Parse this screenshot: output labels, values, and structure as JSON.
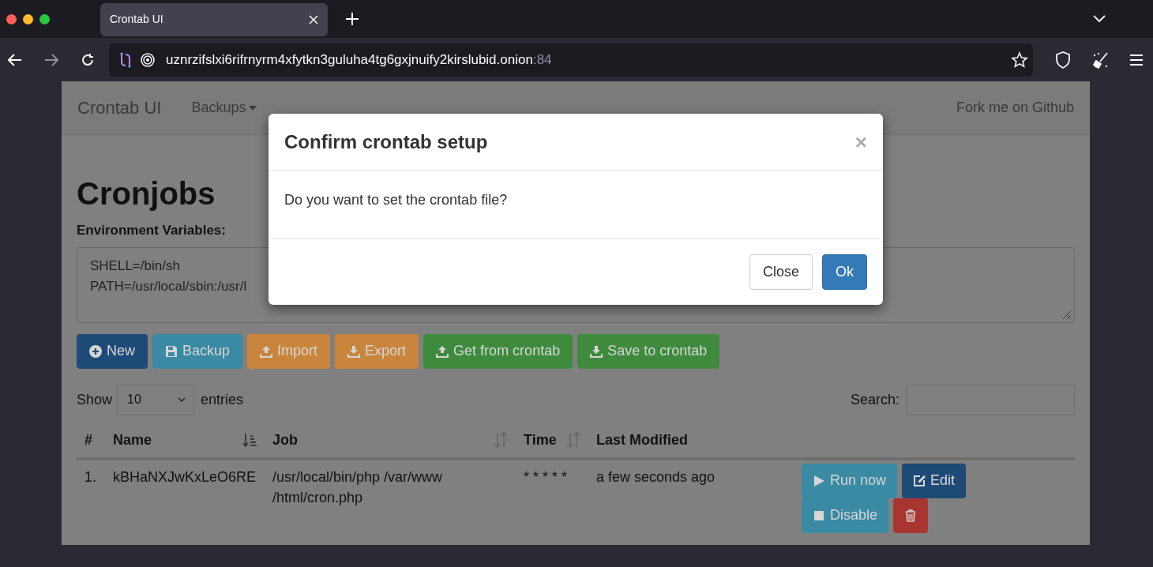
{
  "browser": {
    "tab": {
      "title": "Crontab UI",
      "selected": true
    },
    "url": {
      "host": "uznrzifslxi6rifrnyrm4xfytkn3guluha4tg6gxjnuify2kirslubid.onion",
      "port": ":84"
    }
  },
  "navbar": {
    "brand": "Crontab UI",
    "menu": "Backups",
    "link": "Fork me on Github"
  },
  "heading": "Cronjobs",
  "env": {
    "label": "Environment Variables:",
    "lines": [
      "SHELL=/bin/sh",
      "PATH=/usr/local/sbin:/usr/l"
    ]
  },
  "toolbar": [
    {
      "label": "New",
      "kind": "new"
    },
    {
      "label": "Backup",
      "kind": "backup"
    },
    {
      "label": "Import",
      "kind": "import"
    },
    {
      "label": "Export",
      "kind": "export"
    },
    {
      "label": "Get from crontab",
      "kind": "get"
    },
    {
      "label": "Save to crontab",
      "kind": "save"
    }
  ],
  "length": {
    "label": "Show",
    "value": "10",
    "suffix": "entries"
  },
  "search": {
    "label": "Search:"
  },
  "table": {
    "columns": [
      {
        "label": "#",
        "kind": "plain"
      },
      {
        "label": "Name",
        "kind": "sorted"
      },
      {
        "label": "Job",
        "kind": "sortable"
      },
      {
        "label": "Time",
        "kind": "sortable"
      },
      {
        "label": "Last Modified",
        "kind": "plain"
      }
    ],
    "rows": [
      {
        "index": "1.",
        "name": "kBHaNXJwKxLeO6RE",
        "job": [
          "/usr/local/bin/php /var/www",
          "/html/cron.php"
        ],
        "time": "* * * * *",
        "modified": "a few seconds ago",
        "actions": [
          {
            "label": "Run now",
            "kind": "run"
          },
          {
            "label": "Edit",
            "kind": "edit"
          },
          {
            "label": "Disable",
            "kind": "disable"
          },
          {
            "kind": "delete"
          }
        ]
      }
    ]
  },
  "modal": {
    "title": "Confirm crontab setup",
    "close": "×",
    "body": "Do you want to set the crontab file?",
    "buttons": [
      {
        "label": "Close",
        "kind": "default"
      },
      {
        "label": "Ok",
        "kind": "primary"
      }
    ]
  }
}
